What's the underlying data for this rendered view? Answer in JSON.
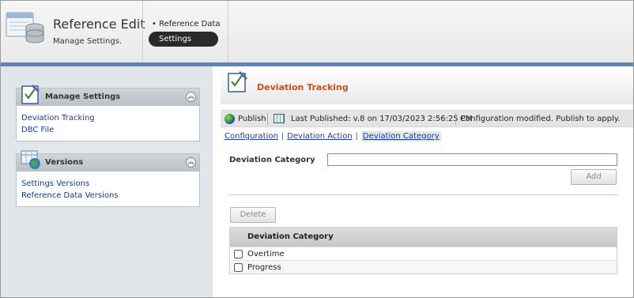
{
  "header": {
    "title": "Reference Edit",
    "subtitle": "Manage Settings.",
    "nav": {
      "reference_data": "• Reference Data",
      "settings": "Settings"
    }
  },
  "sidebar": {
    "manage_settings": {
      "title": "Manage Settings",
      "collapse_icon": "double-chevron-up-icon",
      "links": [
        "Deviation Tracking",
        "DBC File"
      ]
    },
    "versions": {
      "title": "Versions",
      "collapse_icon": "double-chevron-up-icon",
      "links": [
        "Settings Versions",
        "Reference Data Versions"
      ]
    }
  },
  "main": {
    "title": "Deviation Tracking",
    "title_color": "#c8501d",
    "toolbar": {
      "publish": "Publish",
      "last_published": "Last Published: v.8 on 17/03/2023 2:56:25 PM",
      "status": "Configuration modified. Publish to apply."
    },
    "subtabs": [
      "Configuration",
      "Deviation Action",
      "Deviation Category"
    ],
    "active_subtab": "Deviation Category",
    "form": {
      "label": "Deviation Category",
      "value": "",
      "add_label": "Add"
    },
    "delete_label": "Delete",
    "grid": {
      "column": "Deviation Category",
      "rows": [
        "Overtime",
        "Progress"
      ]
    }
  },
  "colors": {
    "accent_bar": "#5a86bd",
    "link": "#1a3a8f"
  }
}
